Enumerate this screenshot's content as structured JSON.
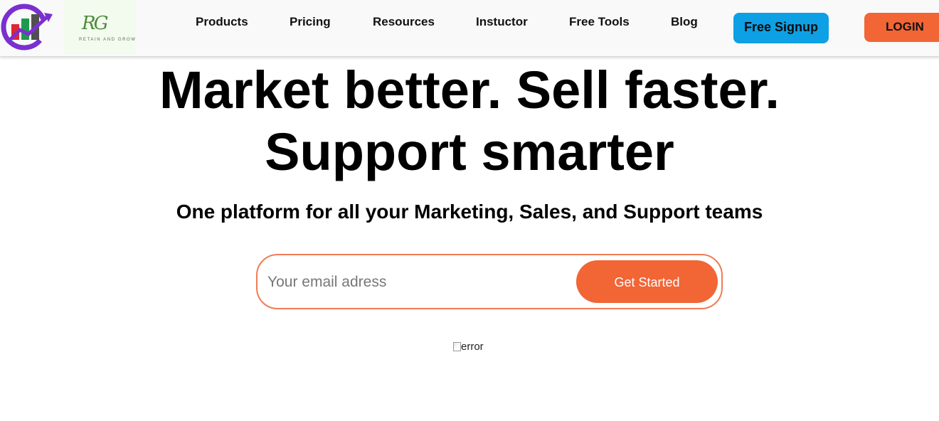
{
  "brand": {
    "rg_letters": "RG",
    "rg_tagline": "RETAIN AND GROW",
    "logo_icon": "chart-logo-icon"
  },
  "nav": {
    "items": [
      {
        "label": "Products"
      },
      {
        "label": "Pricing"
      },
      {
        "label": "Resources"
      },
      {
        "label": "Instuctor"
      },
      {
        "label": "Free Tools"
      },
      {
        "label": "Blog"
      }
    ],
    "signup_label": "Free Signup",
    "login_label": "LOGIN"
  },
  "hero": {
    "title_line1": "Market better. Sell faster.",
    "title_line2": "Support smarter",
    "subtitle": "One platform for all your Marketing, Sales, and Support teams"
  },
  "signup_form": {
    "email_placeholder": "Your email adress",
    "email_value": "",
    "cta_label": "Get Started"
  },
  "hero_image": {
    "alt_text": "error"
  },
  "colors": {
    "accent_orange": "#f26535",
    "signup_blue": "#0ea0e4",
    "logo_purple": "#7a2fd0",
    "logo_green": "#1f9a4d",
    "logo_red": "#e0262f"
  }
}
